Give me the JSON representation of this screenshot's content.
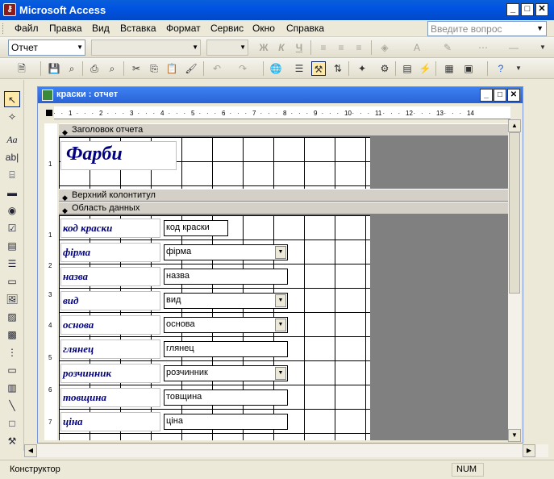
{
  "app": {
    "title": "Microsoft Access",
    "icon_name": "access-app-icon",
    "accent": "#0054E3"
  },
  "menu": {
    "items": [
      "Файл",
      "Правка",
      "Вид",
      "Вставка",
      "Формат",
      "Сервис",
      "Окно",
      "Справка"
    ],
    "help_placeholder": "Введите вопрос"
  },
  "toolbar1": {
    "object_combo": "Отчет"
  },
  "report_window": {
    "title": "краски : отчет",
    "ruler_ticks": [
      "1",
      "2",
      "3",
      "4",
      "5",
      "6",
      "7",
      "8",
      "9",
      "10",
      "11",
      "12",
      "13",
      "14"
    ],
    "left_ruler": [
      "1",
      "1",
      "2",
      "3",
      "4",
      "5",
      "6",
      "7"
    ],
    "sections": {
      "report_header": "Заголовок отчета",
      "page_header": "Верхний колонтитул",
      "detail": "Область данных"
    },
    "report_title": "Фарби",
    "fields": [
      {
        "label": "код краски",
        "control": "код краски",
        "type": "textbox"
      },
      {
        "label": "фірма",
        "control": "фірма",
        "type": "combo"
      },
      {
        "label": "назва",
        "control": "назва",
        "type": "textbox"
      },
      {
        "label": "вид",
        "control": "вид",
        "type": "combo"
      },
      {
        "label": "основа",
        "control": "основа",
        "type": "combo"
      },
      {
        "label": "глянец",
        "control": "глянец",
        "type": "textbox"
      },
      {
        "label": "розчинник",
        "control": "розчинник",
        "type": "combo"
      },
      {
        "label": "товщина",
        "control": "товщина",
        "type": "textbox"
      },
      {
        "label": "ціна",
        "control": "ціна",
        "type": "textbox"
      }
    ]
  },
  "status": {
    "mode": "Конструктор",
    "num": "NUM"
  }
}
